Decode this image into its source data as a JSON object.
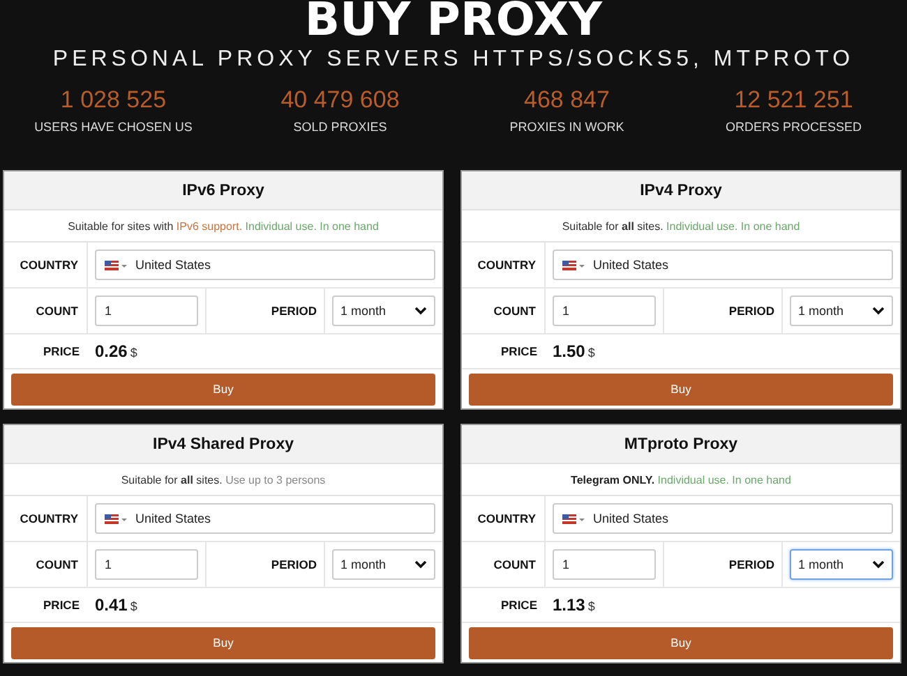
{
  "header": {
    "title": "BUY PROXY",
    "subtitle": "PERSONAL PROXY SERVERS HTTPS/SOCKS5, MTPROTO"
  },
  "stats": [
    {
      "value": "1 028 525",
      "label": "USERS HAVE CHOSEN US"
    },
    {
      "value": "40 479 608",
      "label": "SOLD PROXIES"
    },
    {
      "value": "468 847",
      "label": "PROXIES IN WORK"
    },
    {
      "value": "12 521 251",
      "label": "ORDERS PROCESSED"
    }
  ],
  "cards": [
    {
      "title": "IPv6 Proxy",
      "description": [
        {
          "text": "Suitable for sites with ",
          "color": "#333333"
        },
        {
          "text": "IPv6 support.",
          "color": "#c8743f"
        },
        {
          "text": " Individual use. In one hand",
          "color": "#6aa86a"
        }
      ],
      "country_label": "COUNTRY",
      "country": "United States",
      "count_label": "COUNT",
      "count": "1",
      "period_label": "PERIOD",
      "period": "1 month",
      "period_focused": false,
      "price_label": "PRICE",
      "price": "0.26",
      "currency": "$",
      "button": "Buy"
    },
    {
      "title": "IPv4 Proxy",
      "description": [
        {
          "text": "Suitable for **all** sites.",
          "color": "#333333"
        },
        {
          "text": " Individual use. In one hand",
          "color": "#6aa86a"
        }
      ],
      "country_label": "COUNTRY",
      "country": "United States",
      "count_label": "COUNT",
      "count": "1",
      "period_label": "PERIOD",
      "period": "1 month",
      "period_focused": false,
      "price_label": "PRICE",
      "price": "1.50",
      "currency": "$",
      "button": "Buy"
    },
    {
      "title": "IPv4 Shared Proxy",
      "description": [
        {
          "text": "Suitable for **all** sites.",
          "color": "#333333"
        },
        {
          "text": " Use up to 3 persons",
          "color": "#888888"
        }
      ],
      "country_label": "COUNTRY",
      "country": "United States",
      "count_label": "COUNT",
      "count": "1",
      "period_label": "PERIOD",
      "period": "1 month",
      "period_focused": false,
      "price_label": "PRICE",
      "price": "0.41",
      "currency": "$",
      "button": "Buy"
    },
    {
      "title": "MTproto Proxy",
      "description": [
        {
          "text": "**Telegram ONLY.**",
          "color": "#222222"
        },
        {
          "text": " Individual use. In one hand",
          "color": "#6aa86a"
        }
      ],
      "country_label": "COUNTRY",
      "country": "United States",
      "count_label": "COUNT",
      "count": "1",
      "period_label": "PERIOD",
      "period": "1 month",
      "period_focused": true,
      "price_label": "PRICE",
      "price": "1.13",
      "currency": "$",
      "button": "Buy"
    }
  ]
}
